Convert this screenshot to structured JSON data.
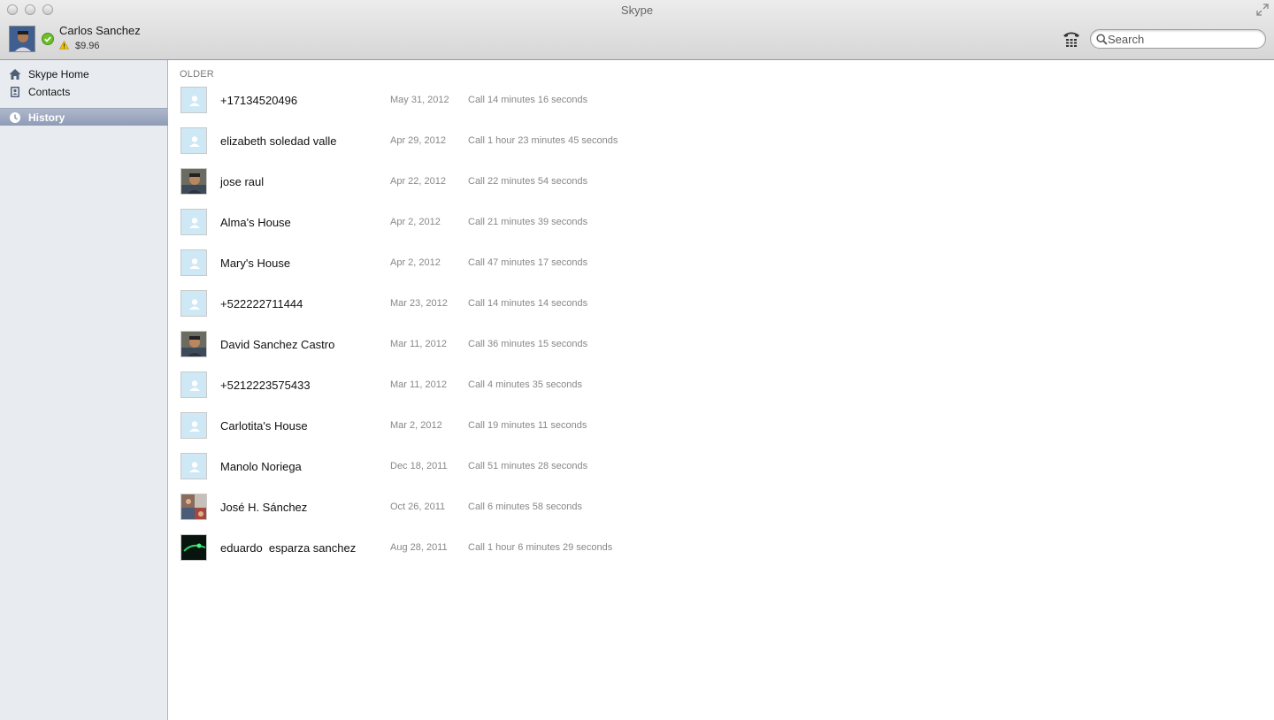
{
  "window": {
    "title": "Skype"
  },
  "profile": {
    "name": "Carlos Sanchez",
    "credit": "$9.96"
  },
  "search": {
    "placeholder": "Search"
  },
  "sidebar": {
    "items": [
      {
        "label": "Skype Home",
        "icon": "home-icon"
      },
      {
        "label": "Contacts",
        "icon": "contacts-icon"
      },
      {
        "label": "History",
        "icon": "history-clock-icon",
        "active": true
      }
    ]
  },
  "history": {
    "section_label": "OLDER",
    "rows": [
      {
        "name": "+17134520496",
        "date": "May 31, 2012",
        "detail": "Call 14 minutes 16 seconds",
        "avatar": "default"
      },
      {
        "name": "elizabeth soledad valle",
        "date": "Apr 29, 2012",
        "detail": "Call 1 hour 23 minutes 45 seconds",
        "avatar": "default"
      },
      {
        "name": "jose raul",
        "date": "Apr 22, 2012",
        "detail": "Call 22 minutes 54 seconds",
        "avatar": "photo"
      },
      {
        "name": "Alma's House",
        "date": "Apr 2, 2012",
        "detail": "Call 21 minutes 39 seconds",
        "avatar": "default"
      },
      {
        "name": "Mary's House",
        "date": "Apr 2, 2012",
        "detail": "Call 47 minutes 17 seconds",
        "avatar": "default"
      },
      {
        "name": "+522222711444",
        "date": "Mar 23, 2012",
        "detail": "Call 14 minutes 14 seconds",
        "avatar": "default"
      },
      {
        "name": "David Sanchez Castro",
        "date": "Mar 11, 2012",
        "detail": "Call 36 minutes 15 seconds",
        "avatar": "photo"
      },
      {
        "name": "+5212223575433",
        "date": "Mar 11, 2012",
        "detail": "Call 4 minutes 35 seconds",
        "avatar": "default"
      },
      {
        "name": "Carlotita's House",
        "date": "Mar 2, 2012",
        "detail": "Call 19 minutes 11 seconds",
        "avatar": "default"
      },
      {
        "name": "Manolo Noriega",
        "date": "Dec 18, 2011",
        "detail": "Call 51 minutes 28 seconds",
        "avatar": "default"
      },
      {
        "name": "José H. Sánchez",
        "date": "Oct 26, 2011",
        "detail": "Call 6 minutes 58 seconds",
        "avatar": "photo-collage"
      },
      {
        "name": "eduardo  esparza sanchez",
        "date": "Aug 28, 2011",
        "detail": "Call 1 hour 6 minutes 29 seconds",
        "avatar": "photo-dark"
      }
    ]
  },
  "colors": {
    "sidebar_bg": "#e8ebf0",
    "sidebar_active": "#8f9cb6",
    "status_online": "#6cbf2a",
    "default_avatar": "#cfe8f5"
  }
}
